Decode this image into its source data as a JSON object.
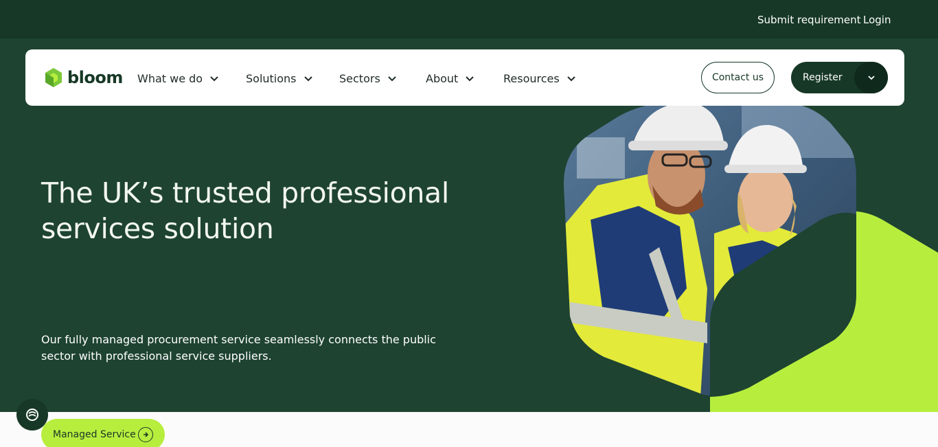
{
  "topbar": {
    "submit_label": "Submit requirement",
    "login_label": "Login"
  },
  "brand": {
    "name": "bloom",
    "accent": "#b7ee3e",
    "dark": "#173826",
    "hero_bg": "#1e4331"
  },
  "nav": {
    "items": [
      {
        "label": "What we do",
        "icon": "chevron-down-icon"
      },
      {
        "label": "Solutions",
        "icon": "chevron-down-icon"
      },
      {
        "label": "Sectors",
        "icon": "chevron-down-icon"
      },
      {
        "label": "About",
        "icon": "chevron-down-icon"
      },
      {
        "label": "Resources",
        "icon": "chevron-down-icon"
      }
    ],
    "contact_label": "Contact us",
    "register_label": "Register"
  },
  "hero": {
    "headline": "The UK’s trusted professional services solution",
    "subtext": "Our fully managed procurement service seamlessly connects the public sector with professional service suppliers.",
    "cta_label": "Managed Service",
    "image_alt": "Two engineers in hard hats and hi-vis jackets"
  },
  "chat": {
    "icon": "chat-icon"
  }
}
